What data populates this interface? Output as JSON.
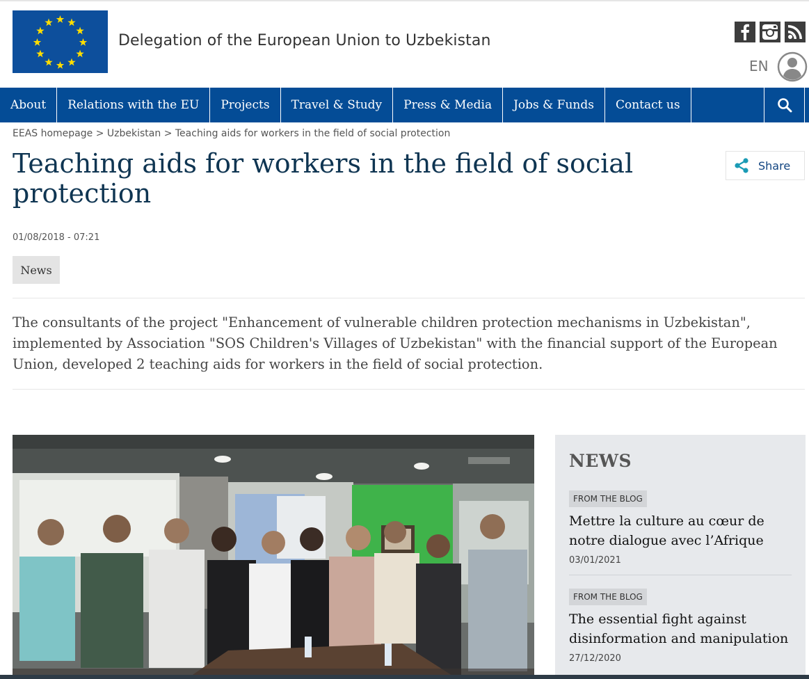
{
  "header": {
    "site_title": "Delegation of the European Union to Uzbekistan",
    "language": "EN",
    "social": [
      {
        "name": "facebook-icon",
        "glyph": "f"
      },
      {
        "name": "instagram-icon",
        "glyph": ""
      },
      {
        "name": "rss-icon",
        "glyph": ""
      }
    ]
  },
  "nav": {
    "items": [
      "About",
      "Relations with the EU",
      "Projects",
      "Travel & Study",
      "Press & Media",
      "Jobs & Funds",
      "Contact us"
    ]
  },
  "breadcrumb": {
    "home": "EEAS homepage",
    "sep": ">",
    "country": "Uzbekistan",
    "current": "Teaching aids for workers in the field of social protection"
  },
  "article": {
    "title": "Teaching aids for workers in the field of social protection",
    "date": "01/08/2018 - 07:21",
    "tag": "News",
    "lead": "The consultants of the project \"Enhancement of vulnerable children protection mechanisms in Uzbekistan\", implemented by Association \"SOS Children's Villages of Uzbekistan\" with the financial support of the European Union, developed 2 teaching aids for workers in the field of social protection.",
    "share_label": "Share"
  },
  "sidebar": {
    "title": "NEWS",
    "items": [
      {
        "badge": "FROM THE BLOG",
        "title": "Mettre la culture au cœur de notre dialogue avec l’Afrique",
        "date": "03/01/2021"
      },
      {
        "badge": "FROM THE BLOG",
        "title": "The essential fight against disinformation and manipulation",
        "date": "27/12/2020"
      }
    ]
  },
  "colors": {
    "nav_bg": "#044c96",
    "flag_blue": "#0d4f9c",
    "flag_star": "#ffdd00",
    "title_color": "#0f3552",
    "sidebar_bg": "#e7e9ec"
  }
}
